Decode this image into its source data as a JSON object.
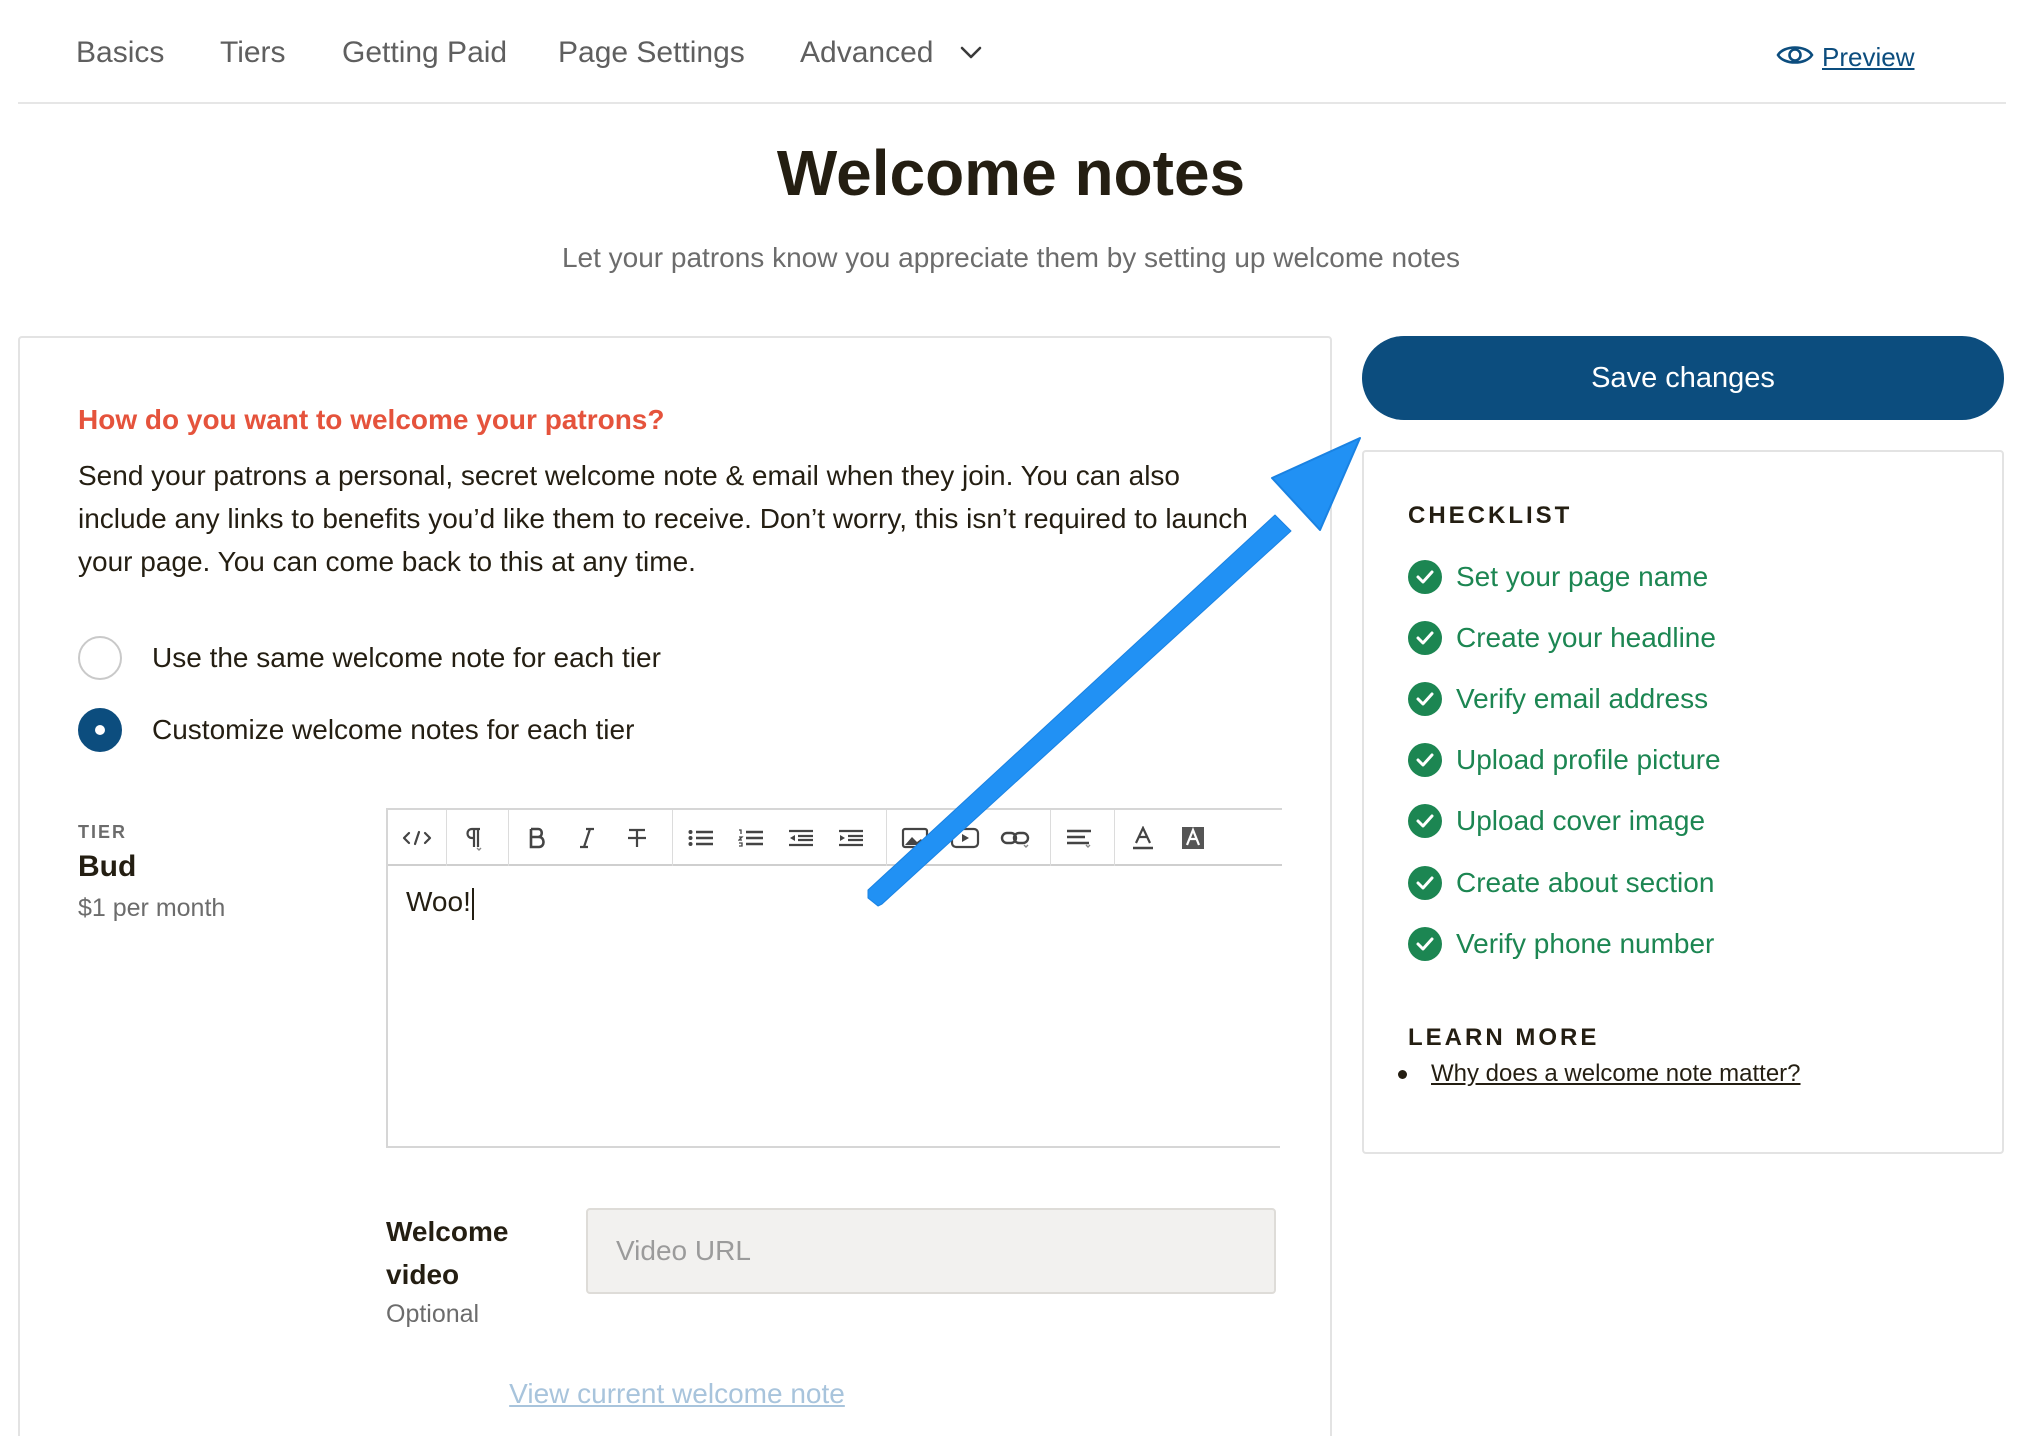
{
  "nav": {
    "tabs": [
      {
        "label": "Basics"
      },
      {
        "label": "Tiers"
      },
      {
        "label": "Getting Paid"
      },
      {
        "label": "Page Settings"
      },
      {
        "label": "Advanced"
      }
    ],
    "preview_label": "Preview",
    "preview_icon": "eye-icon"
  },
  "header": {
    "title": "Welcome notes",
    "subtitle": "Let your patrons know you appreciate them by setting up welcome notes"
  },
  "form": {
    "question": "How do you want to welcome your patrons?",
    "intro": "Send your patrons a personal, secret welcome note & email when they join. You can also include any links to benefits you’d like them to receive. Don’t worry, this isn’t required to launch your page. You can come back to this at any time.",
    "options": [
      {
        "label": "Use the same welcome note for each tier",
        "selected": false
      },
      {
        "label": "Customize welcome notes for each tier",
        "selected": true
      }
    ],
    "tier": {
      "caption": "TIER",
      "name": "Bud",
      "price": "$1 per month"
    },
    "editor": {
      "content": "Woo!",
      "toolbar": [
        "code-view-icon",
        "paragraph-icon",
        "bold-icon",
        "italic-icon",
        "strikethrough-icon",
        "bullet-list-icon",
        "numbered-list-icon",
        "outdent-icon",
        "indent-icon",
        "image-icon",
        "video-icon",
        "link-icon",
        "align-icon",
        "text-color-icon",
        "highlight-icon"
      ]
    },
    "video": {
      "label_line1": "Welcome",
      "label_line2": "video",
      "optional": "Optional",
      "placeholder": "Video URL",
      "value": ""
    },
    "view_current": "View current welcome note"
  },
  "sidebar": {
    "save_label": "Save changes",
    "checklist_title": "CHECKLIST",
    "checklist": [
      {
        "label": "Set your page name",
        "done": true
      },
      {
        "label": "Create your headline",
        "done": true
      },
      {
        "label": "Verify email address",
        "done": true
      },
      {
        "label": "Upload profile picture",
        "done": true
      },
      {
        "label": "Upload cover image",
        "done": true
      },
      {
        "label": "Create about section",
        "done": true
      },
      {
        "label": "Verify phone number",
        "done": true
      }
    ],
    "learn_more_title": "LEARN MORE",
    "learn_more_links": [
      {
        "label": "Why does a welcome note matter?"
      }
    ]
  },
  "colors": {
    "brand": "#0c4d7e",
    "accent_red": "#e5533c",
    "success_green": "#1c8652",
    "annotation_arrow": "#2191f4"
  }
}
